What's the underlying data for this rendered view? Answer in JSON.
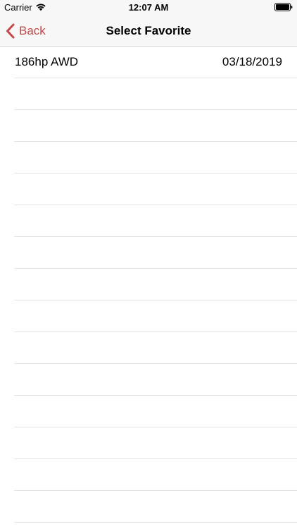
{
  "status_bar": {
    "carrier": "Carrier",
    "time": "12:07 AM",
    "wifi_icon": "wifi-icon",
    "battery_icon": "battery-full-icon"
  },
  "nav": {
    "back_label": "Back",
    "back_icon": "chevron-left-icon",
    "title": "Select Favorite",
    "accent_color": "#c54848"
  },
  "favorites": [
    {
      "name": "186hp AWD",
      "date": "03/18/2019"
    }
  ]
}
